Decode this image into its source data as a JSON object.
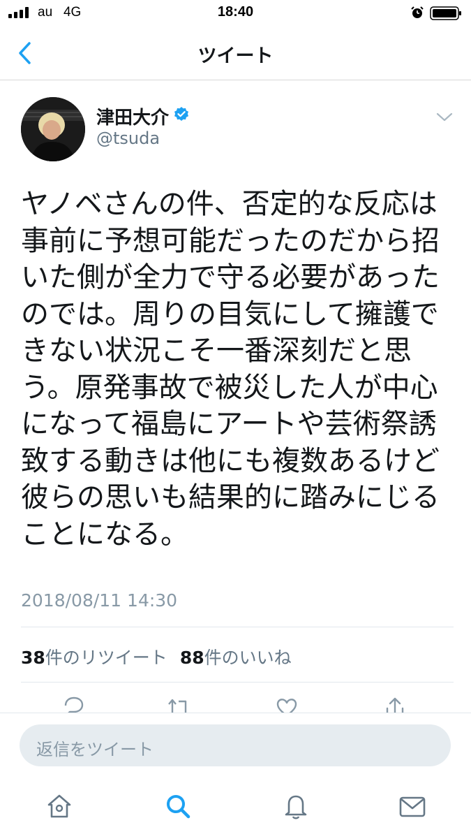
{
  "status_bar": {
    "carrier": "au",
    "network": "4G",
    "time": "18:40",
    "icons": [
      "signal-icon",
      "alarm-icon",
      "battery-icon"
    ]
  },
  "nav": {
    "title": "ツイート",
    "back_icon": "chevron-left-icon"
  },
  "tweet": {
    "author_name": "津田大介",
    "author_handle": "@tsuda",
    "verified": true,
    "text_lines": [
      "ヤノベさんの件、否定的な反応は",
      "事前に予想可能だったのだから招",
      "いた側が全力で守る必要があった",
      "のでは。周りの目気にして擁護で",
      "きない状況こそ一番深刻だと思",
      "う。原発事故で被災した人が中心",
      "になって福島にアートや芸術祭誘",
      "致する動きは他にも複数あるけど",
      "彼らの思いも結果的に踏みにじる",
      "ことになる。"
    ],
    "timestamp": "2018/08/11 14:30",
    "retweet_count": "38",
    "retweet_label": "件のリツイート",
    "like_count": "88",
    "like_label": "件のいいね"
  },
  "actions": [
    "reply-icon",
    "retweet-icon",
    "like-icon",
    "share-icon"
  ],
  "reply": {
    "placeholder": "返信をツイート"
  },
  "tab_bar": [
    "home-icon",
    "search-icon",
    "notifications-icon",
    "messages-icon"
  ],
  "colors": {
    "accent": "#1da1f2",
    "text": "#14171a",
    "secondary": "#657786",
    "muted": "#8899a6",
    "input_bg": "#e6ecf0"
  }
}
